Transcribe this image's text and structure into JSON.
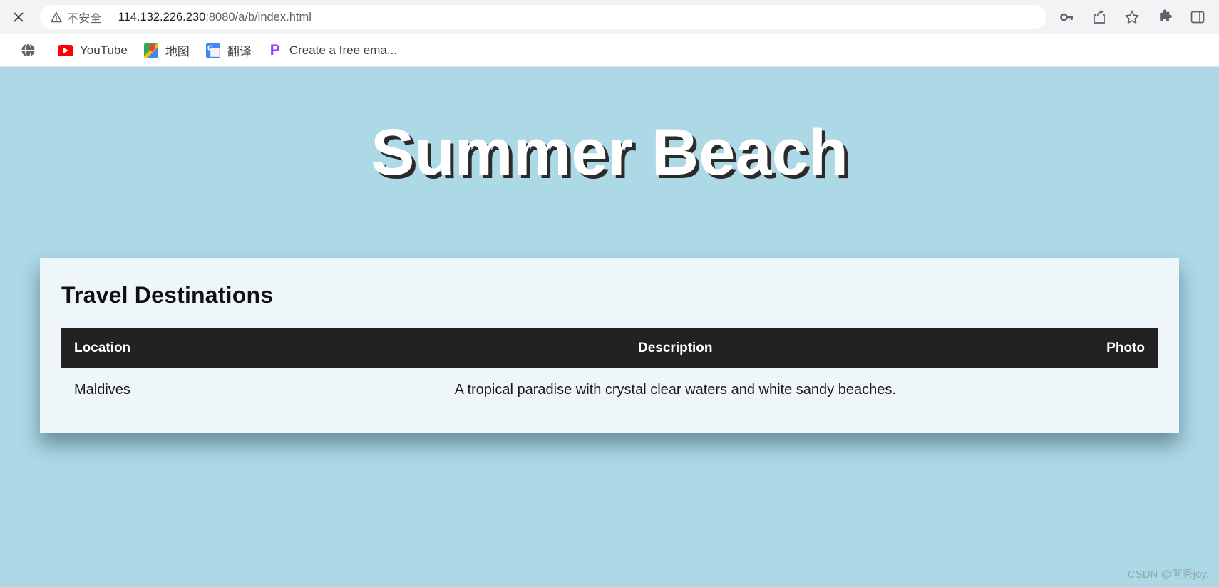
{
  "browser": {
    "close_tab_icon": "close-icon",
    "omnibox": {
      "warning_icon": "warning-triangle-icon",
      "security_label": "不安全",
      "url_host": "114.132.226.230",
      "url_rest": ":8080/a/b/index.html",
      "full_url": "114.132.226.230:8080/a/b/index.html"
    },
    "right_icons": [
      {
        "name": "password-key-icon",
        "glyph": "key"
      },
      {
        "name": "share-icon",
        "glyph": "share"
      },
      {
        "name": "bookmark-star-icon",
        "glyph": "star"
      },
      {
        "name": "extensions-puzzle-icon",
        "glyph": "puzzle"
      },
      {
        "name": "side-panel-icon",
        "glyph": "panel"
      }
    ],
    "bookmarks": [
      {
        "name": "bookmark-globe",
        "icon": "globe-icon",
        "label": ""
      },
      {
        "name": "bookmark-youtube",
        "icon": "youtube-icon",
        "label": "YouTube"
      },
      {
        "name": "bookmark-maps",
        "icon": "google-maps-icon",
        "label": "地图"
      },
      {
        "name": "bookmark-translate",
        "icon": "google-translate-icon",
        "label": "翻译"
      },
      {
        "name": "bookmark-email",
        "icon": "proton-p-icon",
        "label": "Create a free ema..."
      }
    ]
  },
  "page": {
    "title": "Summer Beach",
    "card_title": "Travel Destinations",
    "table": {
      "headers": [
        "Location",
        "Description",
        "Photo"
      ],
      "rows": [
        {
          "location": "Maldives",
          "description": "A tropical paradise with crystal clear waters and white sandy beaches.",
          "photo": ""
        }
      ]
    },
    "watermark": "CSDN @阿秀joy."
  },
  "colors": {
    "page_background": "#add8e6",
    "card_background": "#eef6f9",
    "table_header": "#222222",
    "title_text": "#ffffff",
    "title_shadow": "#2b2b2b"
  }
}
